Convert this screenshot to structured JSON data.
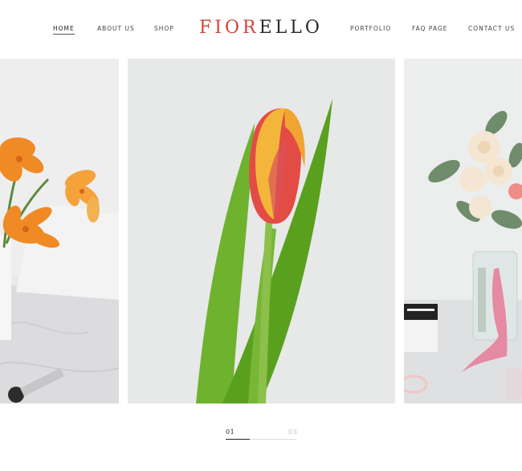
{
  "nav": {
    "left": [
      "HOME",
      "ABOUT US",
      "SHOP"
    ],
    "right": [
      "PORTFOLIO",
      "FAQ PAGE",
      "CONTACT US"
    ],
    "active": "HOME"
  },
  "logo": {
    "accent": "FIOR",
    "rest": "ELLO",
    "accent_color": "#d2433a"
  },
  "slider": {
    "current": "01",
    "total": "03",
    "progress": 0.34,
    "slides": [
      {
        "subject": "orange lilies in vase"
      },
      {
        "subject": "single tulip"
      },
      {
        "subject": "white roses bouquet with pink ribbon"
      }
    ]
  }
}
